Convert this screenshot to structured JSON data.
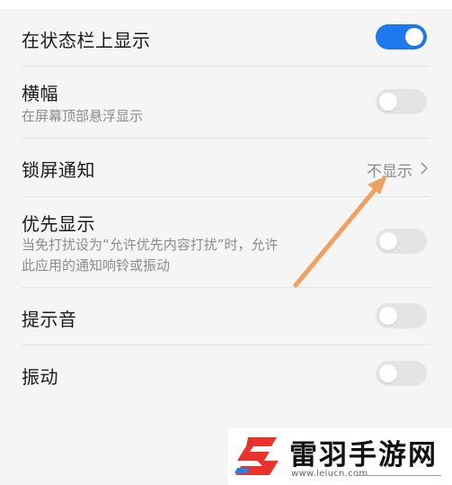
{
  "settings": {
    "status_bar": {
      "title": "在状态栏上显示",
      "enabled": true
    },
    "banner": {
      "title": "横幅",
      "subtitle": "在屏幕顶部悬浮显示",
      "enabled": false
    },
    "lock_screen": {
      "title": "锁屏通知",
      "value": "不显示"
    },
    "priority": {
      "title": "优先显示",
      "subtitle_line1": "当免打扰设为“允许优先内容打扰”时，允许",
      "subtitle_line2": "此应用的通知响铃或振动",
      "enabled": false
    },
    "sound": {
      "title": "提示音",
      "enabled": false
    },
    "vibration": {
      "title": "振动",
      "enabled": false
    }
  },
  "colors": {
    "toggle_on": "#1f78ee",
    "toggle_off": "#e4e4e4",
    "annotation_arrow": "#f0a060",
    "watermark_logo_red": "#e8322c",
    "watermark_logo_blue": "#2e7fe0"
  },
  "watermark": {
    "name": "雷羽手游网",
    "url": "www.leiucn.com"
  }
}
